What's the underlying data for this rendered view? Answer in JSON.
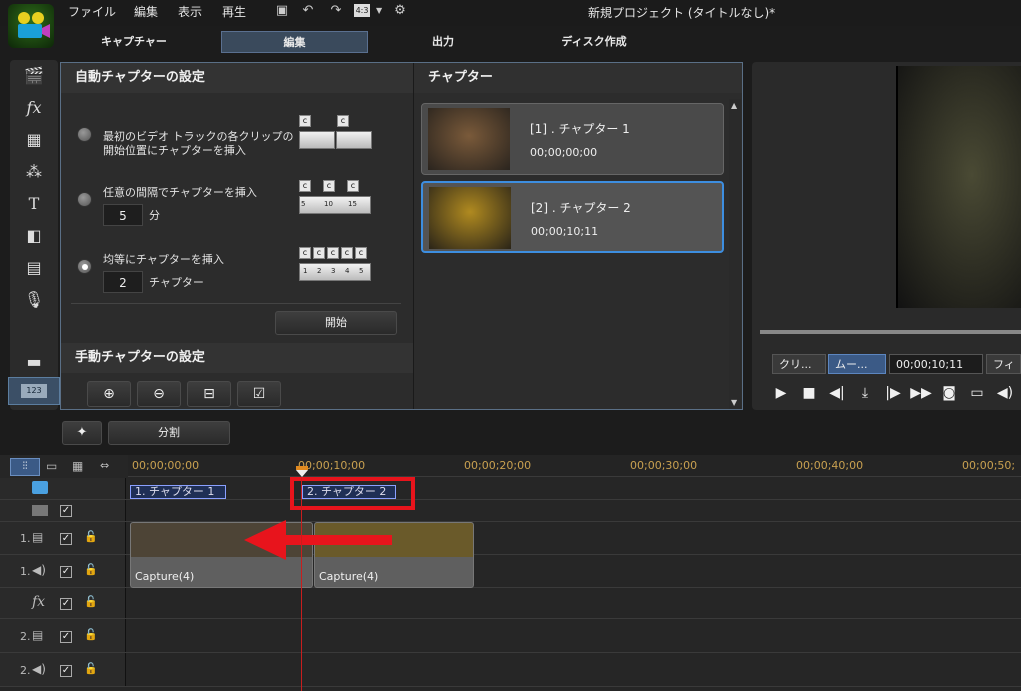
{
  "menu": {
    "file": "ファイル",
    "edit": "編集",
    "view": "表示",
    "play": "再生",
    "project_title": "新規プロジェクト (タイトルなし)*",
    "aspect_label": "4:3"
  },
  "modes": {
    "capture": "キャプチャー",
    "edit": "編集",
    "output": "出力",
    "disc": "ディスク作成"
  },
  "auto_chapter": {
    "title": "自動チャプターの設定",
    "option1_line1": "最初のビデオ トラックの各クリップの",
    "option1_line2": "開始位置にチャプターを挿入",
    "option2": "任意の間隔でチャプターを挿入",
    "interval_value": "5",
    "interval_unit": "分",
    "option3": "均等にチャプターを挿入",
    "count_value": "2",
    "count_unit": "チャプター",
    "start_button": "開始",
    "selected_option": 3,
    "icon_chip": "c",
    "icon2_ticks": [
      "5",
      "10",
      "15"
    ],
    "icon3_ticks": [
      "1",
      "2",
      "3",
      "4",
      "5"
    ]
  },
  "manual_chapter": {
    "title": "手動チャプターの設定"
  },
  "chapter_list": {
    "title": "チャプター",
    "items": [
      {
        "label": "[1] . チャプター 1",
        "time": "00;00;00;00"
      },
      {
        "label": "[2] . チャプター 2",
        "time": "00;00;10;11"
      }
    ]
  },
  "preview": {
    "tab_clip": "クリ...",
    "tab_movie": "ムー...",
    "timecode": "00;00;10;11",
    "tab_fit": "フィ"
  },
  "below_panel": {
    "split_button": "分割"
  },
  "timeline": {
    "ruler": [
      "00;00;00;00",
      "00;00;10;00",
      "00;00;20;00",
      "00;00;30;00",
      "00;00;40;00",
      "00;00;50;"
    ],
    "chapter_markers": [
      "1. チャプター 1",
      "2. チャプター 2"
    ],
    "clips": [
      "Capture(4)",
      "Capture(4)"
    ],
    "tracks": [
      {
        "num": "",
        "kind": "chapter"
      },
      {
        "num": "",
        "kind": "subtitle"
      },
      {
        "num": "1.",
        "kind": "video"
      },
      {
        "num": "1.",
        "kind": "audio"
      },
      {
        "num": "",
        "kind": "fx"
      },
      {
        "num": "2.",
        "kind": "video"
      },
      {
        "num": "2.",
        "kind": "audio"
      }
    ],
    "fx_label": "fx",
    "check_glyph": "✓",
    "lock_glyph": "🔓"
  },
  "colors": {
    "highlight_red": "#e8141c",
    "accent_blue": "#3d8ee0",
    "playhead": "#c81e1e"
  }
}
